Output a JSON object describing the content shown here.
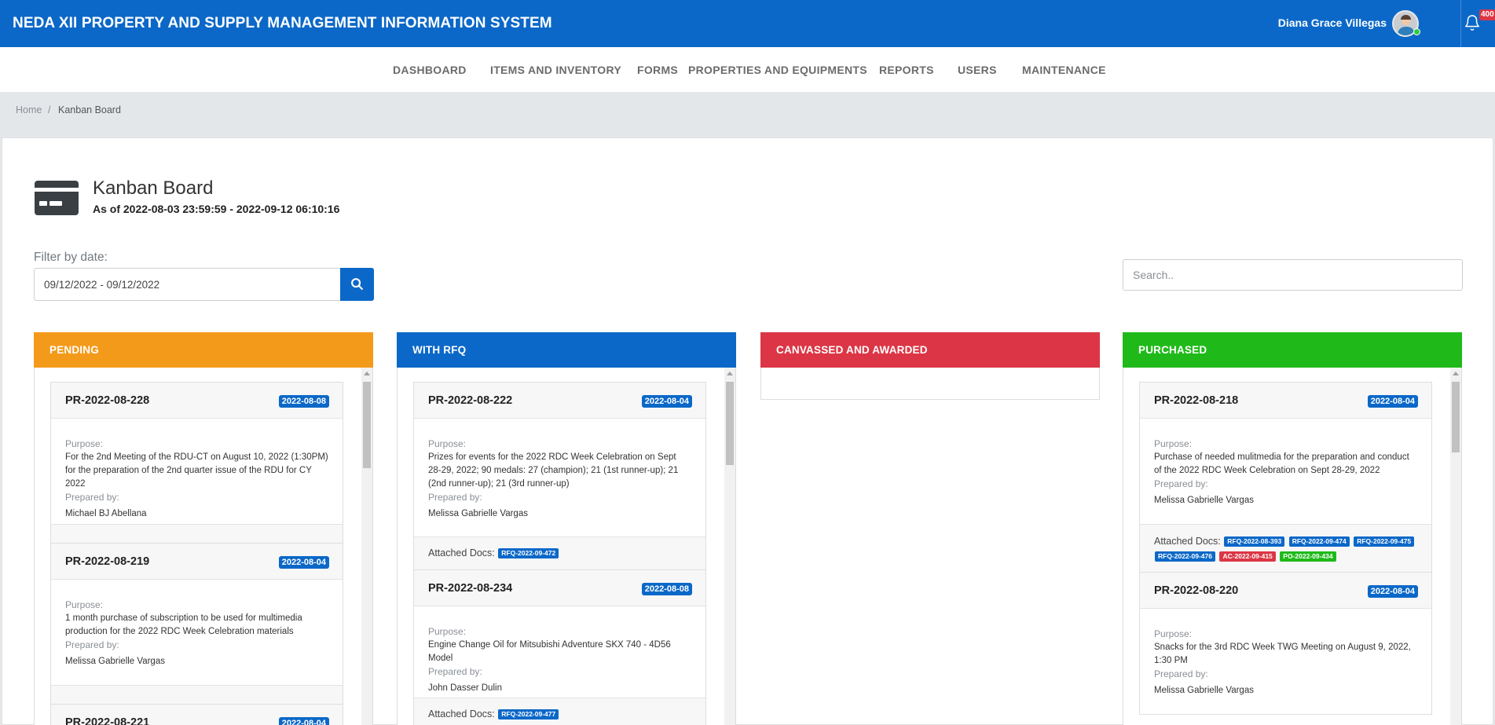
{
  "header": {
    "app_title": "NEDA XII PROPERTY AND SUPPLY MANAGEMENT INFORMATION SYSTEM",
    "user_name": "Diana Grace Villegas",
    "notification_count": "400"
  },
  "nav": {
    "items": [
      "DASHBOARD",
      "ITEMS AND INVENTORY",
      "FORMS",
      "PROPERTIES AND EQUIPMENTS",
      "REPORTS",
      "USERS",
      "MAINTENANCE"
    ]
  },
  "breadcrumb": {
    "home": "Home",
    "separator": "/",
    "current": "Kanban Board"
  },
  "page": {
    "title": "Kanban Board",
    "subtitle": "As of 2022-08-03 23:59:59 - 2022-09-12 06:10:16"
  },
  "filter": {
    "label": "Filter by date:",
    "date_range": "09/12/2022 - 09/12/2022",
    "search_placeholder": "Search.."
  },
  "colors": {
    "primary": "#0b68c8",
    "pending": "#f49a1a",
    "with_rfq": "#0b68c8",
    "canvassed": "#dc3545",
    "purchased": "#1fba1a"
  },
  "labels": {
    "purpose": "Purpose:",
    "prepared_by": "Prepared by:",
    "attached_docs": "Attached Docs:"
  },
  "columns": [
    {
      "title": "PENDING",
      "cards": [
        {
          "id": "PR-2022-08-228",
          "date": "2022-08-08",
          "purpose": "For the 2nd Meeting of the RDU-CT on August 10, 2022 (1:30PM) for the preparation of the 2nd quarter issue of the RDU for CY 2022",
          "prepared_by": "Michael BJ Abellana",
          "docs": []
        },
        {
          "id": "PR-2022-08-219",
          "date": "2022-08-04",
          "purpose": "1 month purchase of subscription to be used for multimedia production for the 2022 RDC Week Celebration materials",
          "prepared_by": "Melissa Gabrielle Vargas",
          "docs": []
        },
        {
          "id": "PR-2022-08-221",
          "date": "2022-08-04",
          "purpose": "",
          "prepared_by": "",
          "docs": []
        }
      ]
    },
    {
      "title": "WITH RFQ",
      "cards": [
        {
          "id": "PR-2022-08-222",
          "date": "2022-08-04",
          "purpose": "Prizes for events for the 2022 RDC Week Celebration on Sept 28-29, 2022; 90 medals: 27 (champion); 21 (1st runner-up); 21 (2nd runner-up); 21 (3rd runner-up)",
          "prepared_by": "Melissa Gabrielle Vargas",
          "docs": [
            {
              "label": "RFQ-2022-09-472",
              "type": "blue"
            }
          ]
        },
        {
          "id": "PR-2022-08-234",
          "date": "2022-08-08",
          "purpose": "Engine Change Oil for Mitsubishi Adventure SKX 740 - 4D56 Model",
          "prepared_by": "John Dasser Dulin",
          "docs": [
            {
              "label": "RFQ-2022-09-477",
              "type": "blue"
            }
          ]
        }
      ]
    },
    {
      "title": "CANVASSED AND AWARDED",
      "cards": []
    },
    {
      "title": "PURCHASED",
      "cards": [
        {
          "id": "PR-2022-08-218",
          "date": "2022-08-04",
          "purpose": "Purchase of needed mulitmedia for the preparation and conduct of the 2022 RDC Week Celebration on Sept 28-29, 2022",
          "prepared_by": "Melissa Gabrielle Vargas",
          "docs": [
            {
              "label": "RFQ-2022-08-393",
              "type": "blue"
            },
            {
              "label": "RFQ-2022-09-474",
              "type": "blue"
            },
            {
              "label": "RFQ-2022-09-475",
              "type": "blue"
            },
            {
              "label": "RFQ-2022-09-476",
              "type": "blue"
            },
            {
              "label": "AC-2022-09-415",
              "type": "red"
            },
            {
              "label": "PO-2022-09-434",
              "type": "green"
            }
          ]
        },
        {
          "id": "PR-2022-08-220",
          "date": "2022-08-04",
          "purpose": "Snacks for the 3rd RDC Week TWG Meeting on August 9, 2022, 1:30 PM",
          "prepared_by": "Melissa Gabrielle Vargas",
          "docs": []
        }
      ]
    }
  ]
}
